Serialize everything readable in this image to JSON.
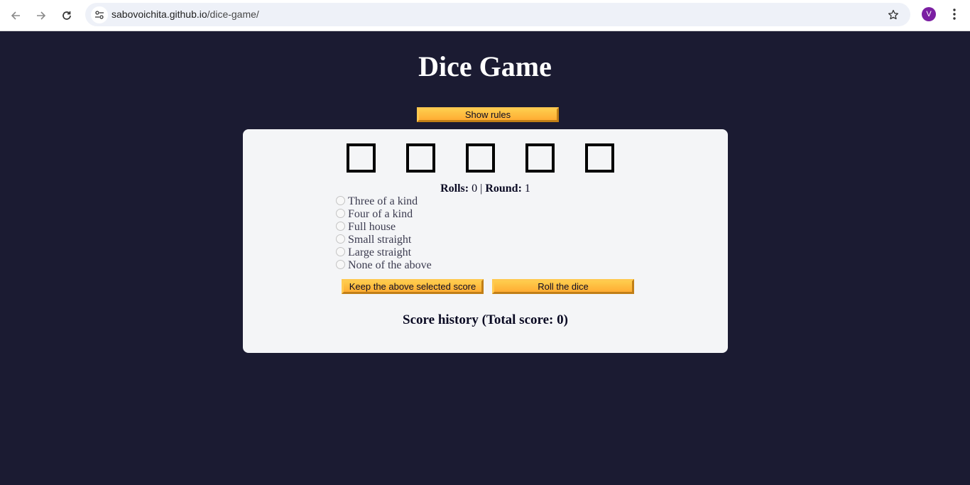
{
  "browser": {
    "url_host": "sabovoichita.github.io",
    "url_path": "/dice-game/",
    "profile_initial": "V",
    "profile_color": "#7b1fa2"
  },
  "page": {
    "title": "Dice Game",
    "show_rules_label": "Show rules",
    "status": {
      "rolls_label": "Rolls:",
      "rolls_value": "0",
      "separator": "|",
      "round_label": "Round:",
      "round_value": "1"
    },
    "score_options": [
      "Three of a kind",
      "Four of a kind",
      "Full house",
      "Small straight",
      "Large straight",
      "None of the above"
    ],
    "keep_score_label": "Keep the above selected score",
    "roll_dice_label": "Roll the dice",
    "score_history_label": "Score history (Total score: 0)"
  },
  "colors": {
    "background": "#1b1b32",
    "panel": "#f4f5f7",
    "button": "#feac32"
  }
}
